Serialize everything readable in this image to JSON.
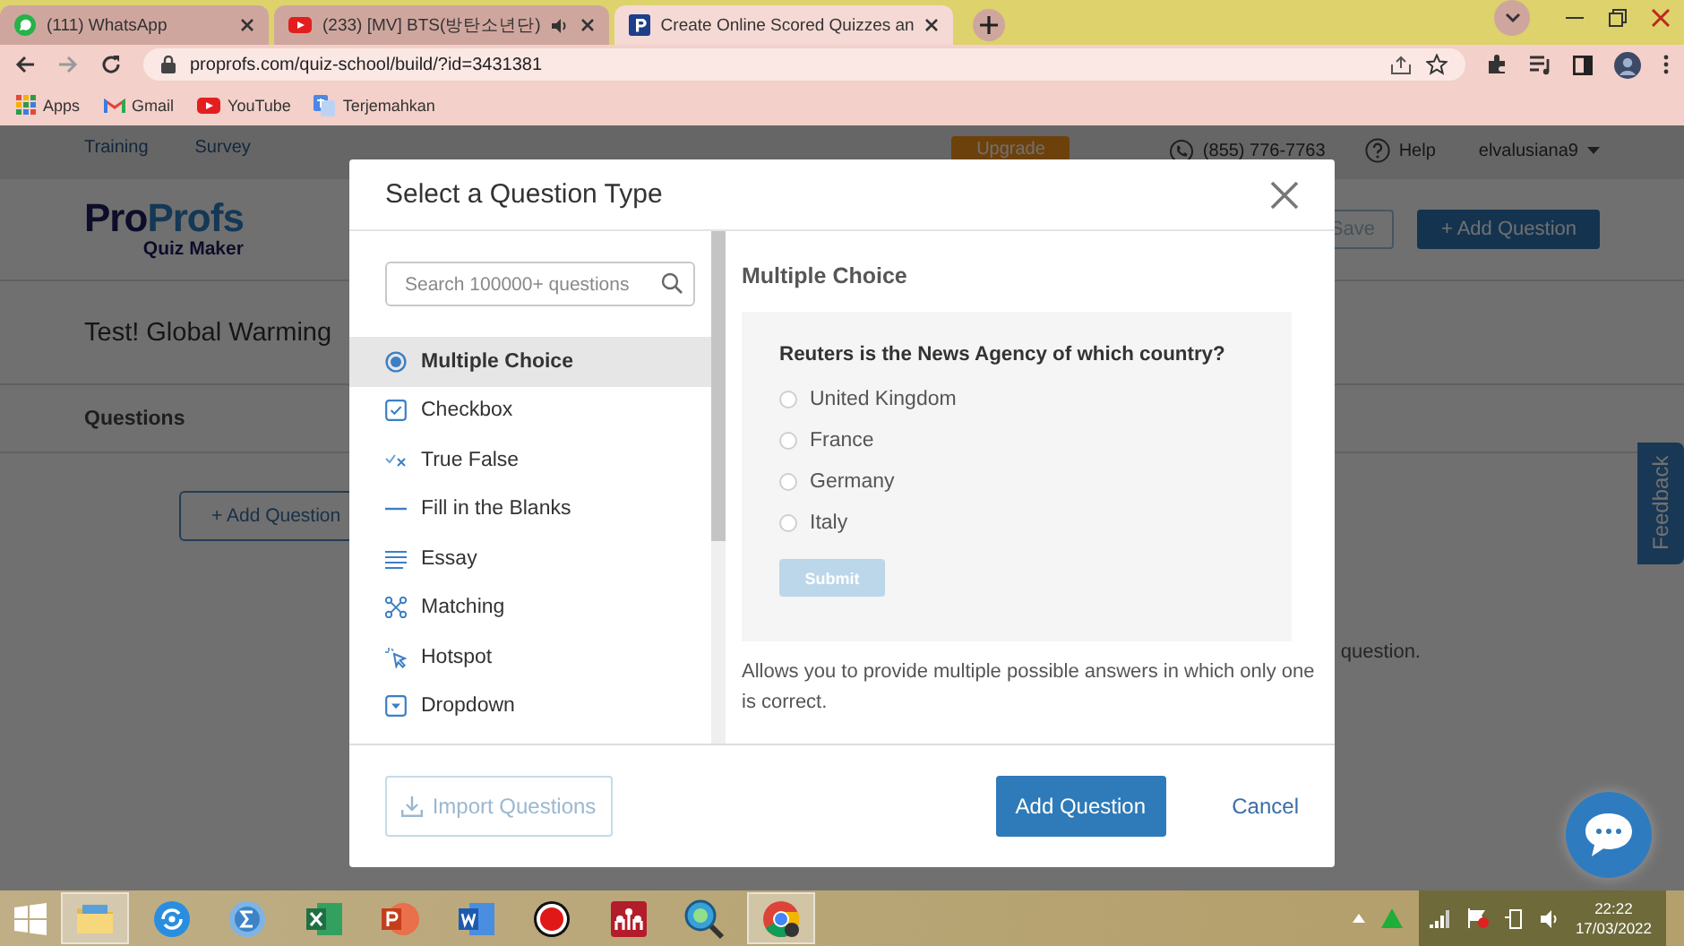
{
  "browser": {
    "tabs": [
      {
        "kind": "chat",
        "title": "(111) WhatsApp",
        "selected": false,
        "audio": false
      },
      {
        "kind": "video",
        "title": "(233) [MV] BTS(방탄소년단)",
        "selected": false,
        "audio": true
      },
      {
        "kind": "quiz",
        "title": "Create Online Scored Quizzes an",
        "selected": true,
        "audio": false
      }
    ],
    "url": "proprofs.com/quiz-school/build/?id=3431381",
    "bookmarks": [
      {
        "kind": "apps",
        "label": "Apps"
      },
      {
        "kind": "mail",
        "label": "Gmail"
      },
      {
        "kind": "video",
        "label": "YouTube"
      },
      {
        "kind": "translate",
        "label": "Terjemahkan"
      }
    ]
  },
  "site": {
    "nav": [
      "Training",
      "Survey"
    ],
    "upgrade": "Upgrade",
    "phone": "(855) 776-7763",
    "help": "Help",
    "user": "elvalusiana9",
    "logo": {
      "parts": [
        "Pro",
        "Profs"
      ],
      "tagline": "Quiz Maker"
    },
    "save": "Save",
    "add_question_primary": "+ Add Question",
    "quiz_title": "Test! Global Warming",
    "section": "Questions",
    "add_question_outline": "+ Add Question",
    "hint_tail": "question.",
    "feedback": "Feedback"
  },
  "dialog": {
    "title": "Select a Question Type",
    "search": {
      "placeholder": "Search 100000+ questions"
    },
    "types": [
      {
        "kind": "radio",
        "label": "Multiple Choice",
        "selected": true
      },
      {
        "kind": "checkbox",
        "label": "Checkbox",
        "selected": false
      },
      {
        "kind": "true_false",
        "label": "True False",
        "selected": false
      },
      {
        "kind": "blank",
        "label": "Fill in the Blanks",
        "selected": false
      },
      {
        "kind": "essay",
        "label": "Essay",
        "selected": false
      },
      {
        "kind": "matching",
        "label": "Matching",
        "selected": false
      },
      {
        "kind": "hotspot",
        "label": "Hotspot",
        "selected": false
      },
      {
        "kind": "dropdown",
        "label": "Dropdown",
        "selected": false
      }
    ],
    "preview": {
      "heading": "Multiple Choice",
      "question": "Reuters is the News Agency of which country?",
      "options": [
        {
          "label": "United Kingdom",
          "selected": false
        },
        {
          "label": "France",
          "selected": false
        },
        {
          "label": "Germany",
          "selected": false
        },
        {
          "label": "Italy",
          "selected": false
        }
      ],
      "submit": {
        "label": "Submit",
        "disabled": true
      }
    },
    "description": "Allows you to provide multiple possible answers in which only one is correct.",
    "import_button": "Import Questions",
    "add_button": "Add Question",
    "cancel": "Cancel"
  },
  "taskbar": {
    "apps": [
      {
        "kind": "explorer",
        "active": true
      },
      {
        "kind": "sync",
        "active": false
      },
      {
        "kind": "math",
        "active": false
      },
      {
        "kind": "sheet",
        "active": false
      },
      {
        "kind": "slides",
        "active": false
      },
      {
        "kind": "doc",
        "active": false
      },
      {
        "kind": "record",
        "active": false
      },
      {
        "kind": "reference",
        "active": false
      },
      {
        "kind": "magnifier",
        "active": false
      },
      {
        "kind": "browser",
        "active": true
      }
    ],
    "time": "22:22",
    "date": "17/03/2022"
  }
}
